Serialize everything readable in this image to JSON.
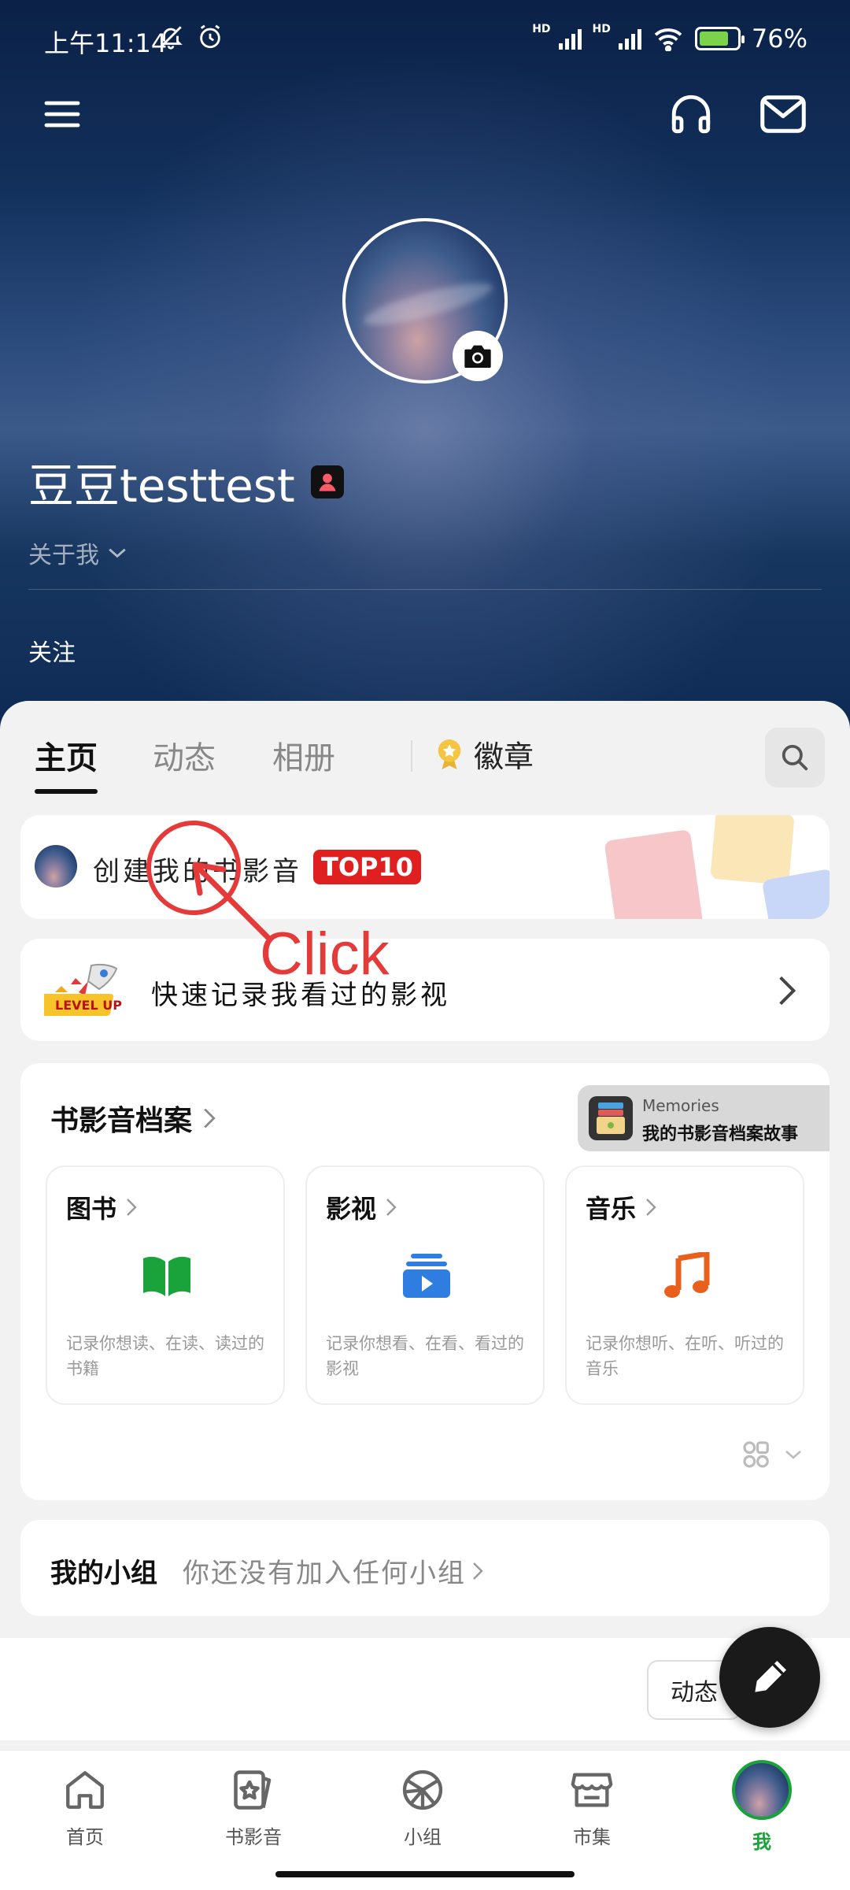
{
  "status_bar": {
    "time": "上午11:14",
    "battery": "76%"
  },
  "header": {
    "username": "豆豆testtest",
    "about_label": "关于我",
    "follow_label": "关注"
  },
  "tabs": [
    {
      "label": "主页"
    },
    {
      "label": "动态"
    },
    {
      "label": "相册"
    }
  ],
  "medal_label": "徽章",
  "create_card": {
    "text": "创建我的书影音",
    "badge": "TOP10"
  },
  "quick_record": {
    "text": "快速记录我看过的影视",
    "badge_text": "LEVEL UP!"
  },
  "archive": {
    "title": "书影音档案",
    "memories_top": "Memories",
    "memories_bottom": "我的书影音档案故事",
    "items": [
      {
        "title": "图书",
        "desc": "记录你想读、在读、读过的书籍",
        "color": "#1aa33a"
      },
      {
        "title": "影视",
        "desc": "记录你想看、在看、看过的影视",
        "color": "#2f7de1"
      },
      {
        "title": "音乐",
        "desc": "记录你想听、在听、听过的音乐",
        "color": "#e8601c"
      }
    ]
  },
  "groups": {
    "title": "我的小组",
    "subtitle": "你还没有加入任何小组"
  },
  "feed_button": "动态",
  "bottom_nav": [
    {
      "label": "首页"
    },
    {
      "label": "书影音"
    },
    {
      "label": "小组"
    },
    {
      "label": "市集"
    },
    {
      "label": "我"
    }
  ],
  "annotation": {
    "text": "Click"
  }
}
